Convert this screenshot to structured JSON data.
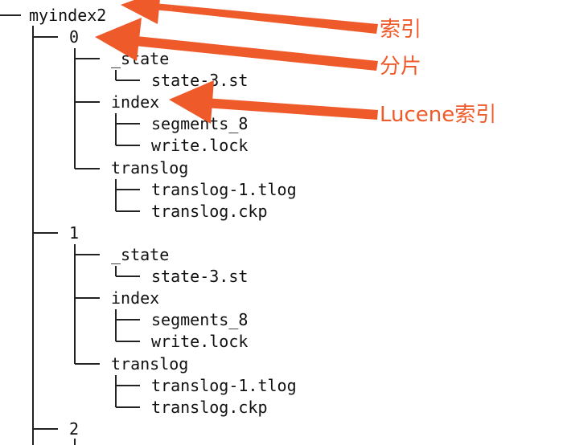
{
  "colors": {
    "annotation": "#ef5a2a",
    "tree_text": "#111111",
    "tree_lines": "#222222"
  },
  "tree": {
    "root": "myindex2",
    "shard_0": {
      "name": "0",
      "state_dir": "_state",
      "state_file": "state-3.st",
      "index_dir": "index",
      "segments_file": "segments_8",
      "lock_file": "write.lock",
      "translog_dir": "translog",
      "translog_file": "translog-1.tlog",
      "checkpoint_file": "translog.ckp"
    },
    "shard_1": {
      "name": "1",
      "state_dir": "_state",
      "state_file": "state-3.st",
      "index_dir": "index",
      "segments_file": "segments_8",
      "lock_file": "write.lock",
      "translog_dir": "translog",
      "translog_file": "translog-1.tlog",
      "checkpoint_file": "translog.ckp"
    },
    "shard_2": {
      "name": "2"
    }
  },
  "annotations": {
    "index_label": "索引",
    "shard_label": "分片",
    "lucene_label": "Lucene索引"
  }
}
